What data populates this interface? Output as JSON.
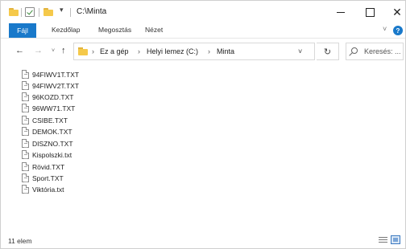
{
  "window": {
    "title": "C:\\Minta",
    "dropdown_glyph": "▾",
    "close_glyph": "✕"
  },
  "ribbon": {
    "tabs": [
      "Fájl",
      "Kezdőlap",
      "Megosztás",
      "Nézet"
    ],
    "collapse_glyph": "˅",
    "help_glyph": "?"
  },
  "nav": {
    "back_glyph": "←",
    "forward_glyph": "→",
    "recent_glyph": "˅",
    "up_glyph": "↑",
    "breadcrumb": [
      "Ez a gép",
      "Helyi lemez (C:)",
      "Minta"
    ],
    "separator": "›",
    "address_dropdown_glyph": "˅",
    "refresh_glyph": "↻",
    "search_placeholder": "Keresés: ..."
  },
  "files": [
    "94FIWV1T.TXT",
    "94FIWV2T.TXT",
    "96KOZD.TXT",
    "96WW71.TXT",
    "CSIBE.TXT",
    "DEMOK.TXT",
    "DISZNO.TXT",
    "Kispolszki.txt",
    "Rövid.TXT",
    "Sport.TXT",
    "Viktória.txt"
  ],
  "status": {
    "item_count": "11 elem"
  },
  "icons": {
    "file": "text-file-icon",
    "folder": "folder-icon",
    "search": "search-icon"
  },
  "colors": {
    "accent": "#1979ca",
    "folder": "#f5c94a"
  }
}
